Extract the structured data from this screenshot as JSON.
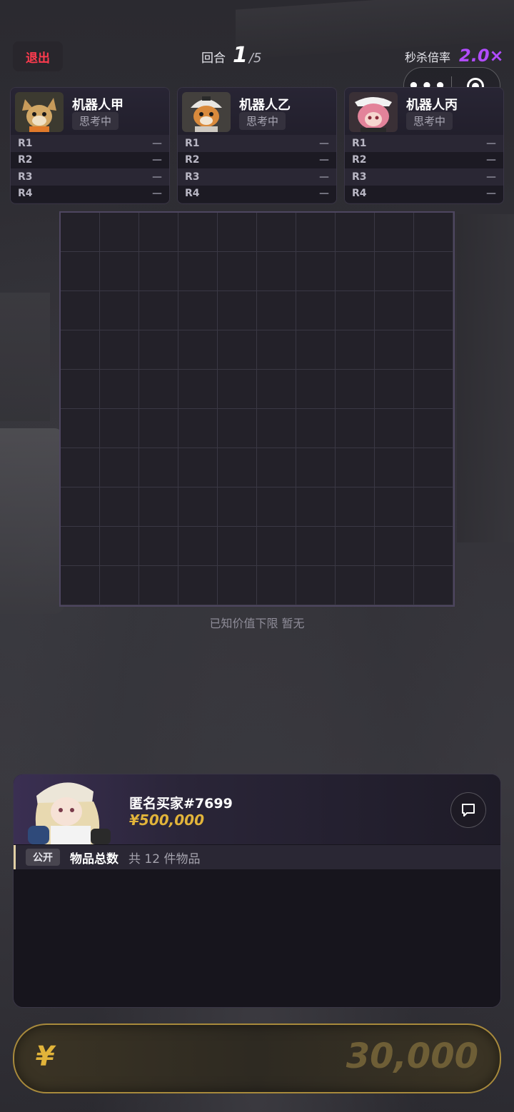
{
  "header": {
    "exit_label": "退出",
    "round_label": "回合",
    "round_current": "1",
    "round_total": "/5",
    "multiplier_label": "秒杀倍率",
    "multiplier_value": "2.0×"
  },
  "capsule": {
    "more_icon": "more-dots-icon",
    "close_icon": "target-icon"
  },
  "robots": [
    {
      "name": "机器人甲",
      "status": "思考中",
      "avatar_icon": "fox-robot-avatar",
      "rounds": [
        {
          "label": "R1",
          "value": "—"
        },
        {
          "label": "R2",
          "value": "—"
        },
        {
          "label": "R3",
          "value": "—"
        },
        {
          "label": "R4",
          "value": "—"
        }
      ]
    },
    {
      "name": "机器人乙",
      "status": "思考中",
      "avatar_icon": "tiger-robot-avatar",
      "rounds": [
        {
          "label": "R1",
          "value": "—"
        },
        {
          "label": "R2",
          "value": "—"
        },
        {
          "label": "R3",
          "value": "—"
        },
        {
          "label": "R4",
          "value": "—"
        }
      ]
    },
    {
      "name": "机器人丙",
      "status": "思考中",
      "avatar_icon": "pink-girl-avatar",
      "rounds": [
        {
          "label": "R1",
          "value": "—"
        },
        {
          "label": "R2",
          "value": "—"
        },
        {
          "label": "R3",
          "value": "—"
        },
        {
          "label": "R4",
          "value": "—"
        }
      ]
    }
  ],
  "grid": {
    "rows": 10,
    "cols": 10,
    "known_value_text": "已知价值下限 暂无"
  },
  "buyer": {
    "name": "匿名买家#7699",
    "money": "¥500,000",
    "avatar_icon": "anime-girl-avatar",
    "chat_icon": "chat-bubble-icon",
    "info_badge": "公开",
    "info_title": "物品总数",
    "info_count": "共 12 件物品"
  },
  "bid": {
    "currency": "¥",
    "value": "30,000"
  },
  "colors": {
    "accent_red": "#ff3b4e",
    "accent_purple": "#b14cff",
    "gold": "#e2b43a"
  }
}
